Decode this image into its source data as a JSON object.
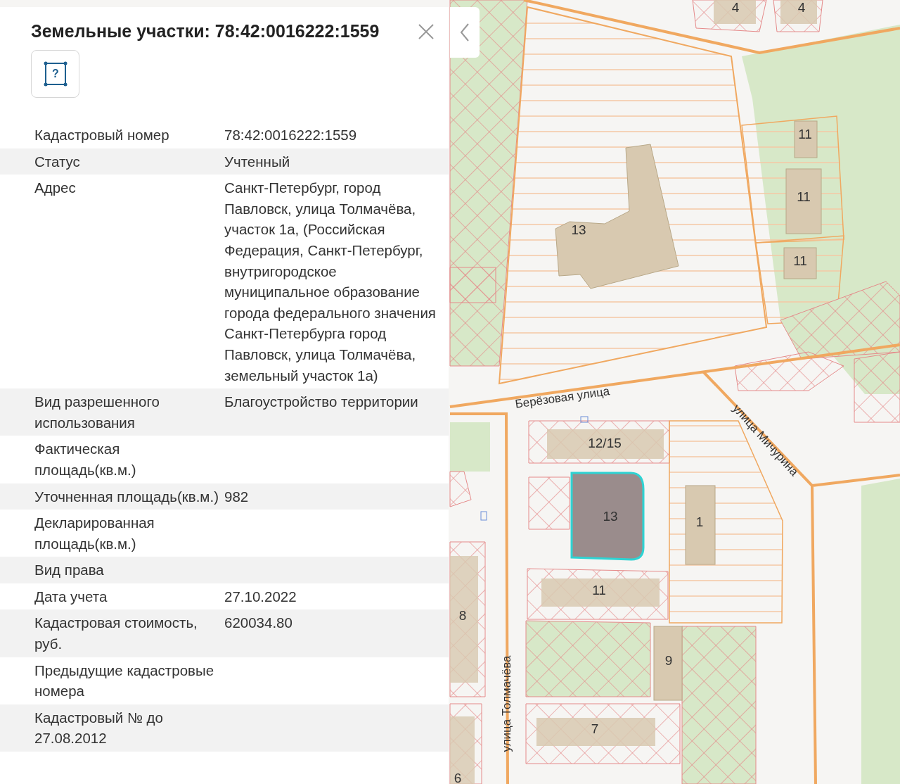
{
  "panel": {
    "title": "Земельные участки: 78:42:0016222:1559",
    "type_button": {
      "glyph": "?"
    },
    "rows": [
      {
        "label": "Кадастровый номер",
        "value": "78:42:0016222:1559"
      },
      {
        "label": "Статус",
        "value": "Учтенный"
      },
      {
        "label": "Адрес",
        "value": "Санкт-Петербург, город Павловск, улица Толмачёва, участок 1а, (Российская Федерация, Санкт-Петербург, внутригородское муниципальное образование города федерального значения Санкт-Петербурга город Павловск, улица Толмачёва, земельный участок 1а)"
      },
      {
        "label": "Вид разрешенного использования",
        "value": "Благоустройство территории"
      },
      {
        "label": "Фактическая площадь(кв.м.)"
      },
      {
        "label": "Уточненная площадь(кв.м.)",
        "value": "982"
      },
      {
        "label": "Декларированная площадь(кв.м.)"
      },
      {
        "label": "Вид права"
      },
      {
        "label": "Дата учета",
        "value": "27.10.2022"
      },
      {
        "label": "Кадастровая стоимость, руб.",
        "value": "620034.80"
      },
      {
        "label": "Предыдущие кадастровые номера"
      },
      {
        "label": "Кадастровый № до 27.08.2012"
      }
    ]
  },
  "map": {
    "building_numbers": [
      "4",
      "4",
      "11",
      "11",
      "11",
      "13",
      "12/15",
      "13",
      "1",
      "11",
      "8",
      "9",
      "7",
      "6"
    ],
    "street_names": [
      "Берёзовая улица",
      "улица Мичурина",
      "улица Толмачёва"
    ]
  }
}
